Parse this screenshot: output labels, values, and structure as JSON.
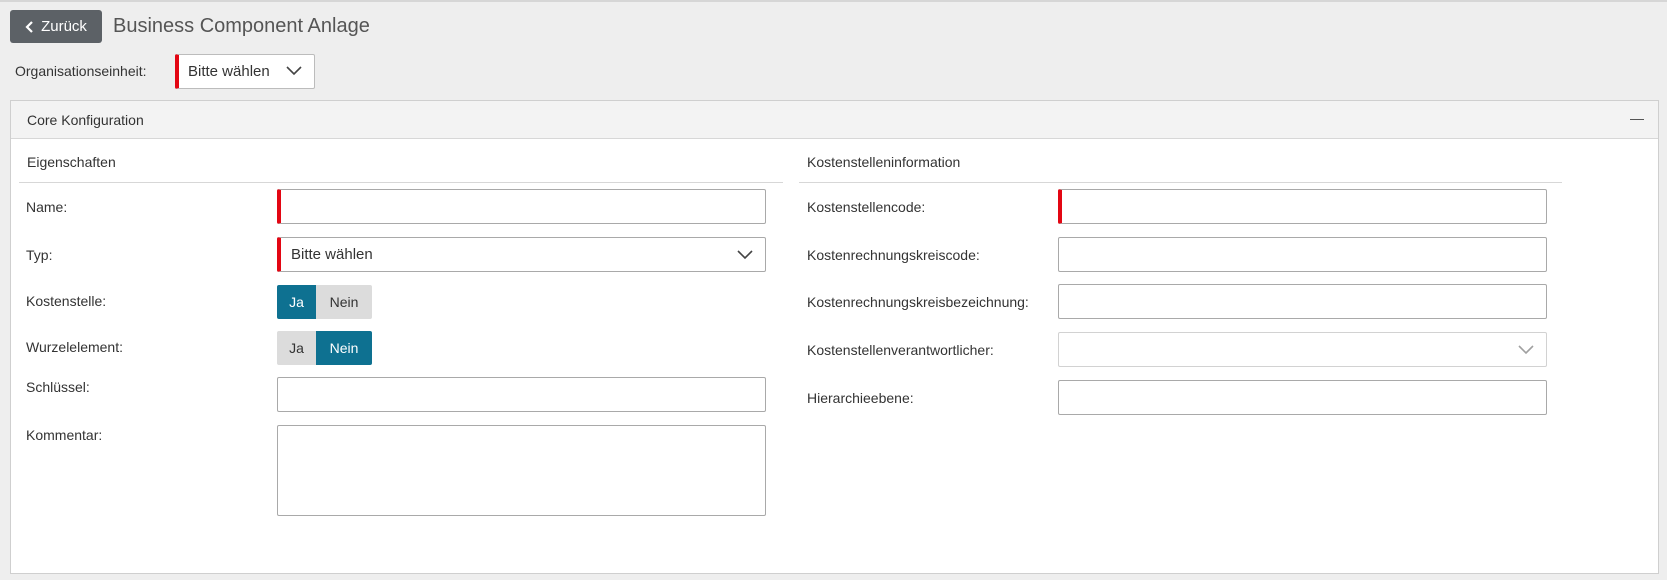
{
  "header": {
    "back_label": "Zurück",
    "title": "Business Component Anlage"
  },
  "org": {
    "label": "Organisationseinheit:",
    "select_value": "Bitte wählen"
  },
  "panel": {
    "title": "Core Konfiguration"
  },
  "left": {
    "section_title": "Eigenschaften",
    "name_label": "Name:",
    "name_value": "",
    "typ_label": "Typ:",
    "typ_value": "Bitte wählen",
    "kostenstelle_label": "Kostenstelle:",
    "kostenstelle": {
      "yes": "Ja",
      "no": "Nein",
      "selected": "Ja"
    },
    "wurzel_label": "Wurzelelement:",
    "wurzel": {
      "yes": "Ja",
      "no": "Nein",
      "selected": "Nein"
    },
    "schluessel_label": "Schlüssel:",
    "schluessel_value": "",
    "kommentar_label": "Kommentar:",
    "kommentar_value": ""
  },
  "right": {
    "section_title": "Kostenstelleninformation",
    "code_label": "Kostenstellencode:",
    "code_value": "",
    "kreiscode_label": "Kostenrechnungskreiscode:",
    "kreiscode_value": "",
    "kreisbez_label": "Kostenrechnungskreisbezeichnung:",
    "kreisbez_value": "",
    "verantw_label": "Kostenstellenverantwortlicher:",
    "verantw_value": "",
    "ebene_label": "Hierarchieebene:",
    "ebene_value": ""
  },
  "colors": {
    "accent": "#0e7191",
    "required": "#e30613",
    "back_button": "#5c6166"
  },
  "icons": {
    "back": "chevron-left-icon",
    "dropdown": "chevron-down-icon",
    "collapse": "minus-icon"
  }
}
